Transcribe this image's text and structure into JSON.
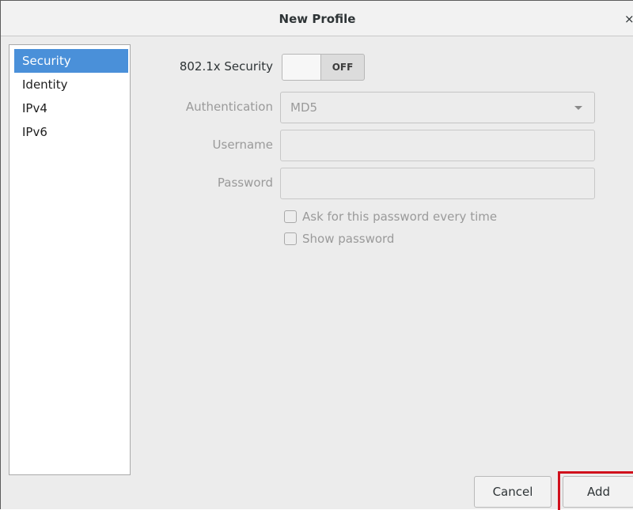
{
  "window": {
    "title": "New Profile",
    "close_glyph": "×"
  },
  "sidebar": {
    "items": [
      {
        "label": "Security",
        "selected": true
      },
      {
        "label": "Identity",
        "selected": false
      },
      {
        "label": "IPv4",
        "selected": false
      },
      {
        "label": "IPv6",
        "selected": false
      }
    ]
  },
  "form": {
    "security_label": "802.1x Security",
    "security_toggle_state": "OFF",
    "authentication_label": "Authentication",
    "authentication_value": "MD5",
    "username_label": "Username",
    "username_value": "",
    "password_label": "Password",
    "password_value": "",
    "ask_password_label": "Ask for this password every time",
    "ask_password_checked": false,
    "show_password_label": "Show password",
    "show_password_checked": false
  },
  "footer": {
    "cancel_label": "Cancel",
    "add_label": "Add"
  },
  "colors": {
    "selection": "#4a90d9",
    "highlight": "#d0101c"
  }
}
